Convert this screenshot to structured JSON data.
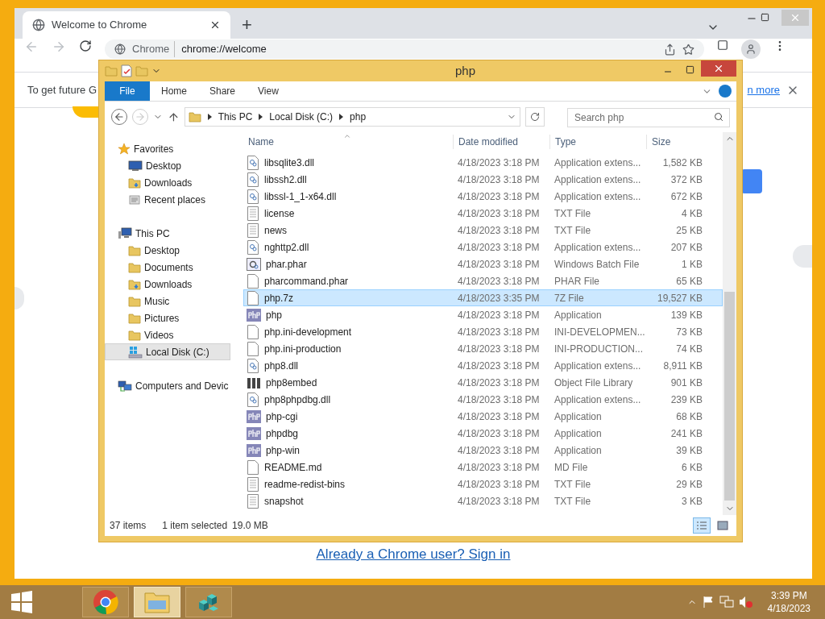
{
  "browser": {
    "tab": {
      "title": "Welcome to Chrome"
    },
    "new_tab": "+",
    "address": {
      "site": "Chrome",
      "url": "chrome://welcome"
    },
    "infobar": {
      "text": "To get future G",
      "link": "n more"
    },
    "sign_in_link": "Already a Chrome user? Sign in"
  },
  "explorer": {
    "title": "php",
    "ribbon_tabs": [
      {
        "label": "File",
        "kind": "file"
      },
      {
        "label": "Home",
        "kind": "tab"
      },
      {
        "label": "Share",
        "kind": "tab"
      },
      {
        "label": "View",
        "kind": "tab"
      }
    ],
    "breadcrumbs": [
      "This PC",
      "Local Disk (C:)",
      "php"
    ],
    "search": {
      "placeholder": "Search php"
    },
    "nav": [
      {
        "label": "Favorites",
        "kind": "star",
        "children": [
          {
            "label": "Desktop",
            "kind": "desktop",
            "selected": false
          },
          {
            "label": "Downloads",
            "kind": "downloads",
            "selected": false
          },
          {
            "label": "Recent places",
            "kind": "recent",
            "selected": false
          }
        ]
      },
      {
        "label": "This PC",
        "kind": "pc",
        "children": [
          {
            "label": "Desktop",
            "kind": "folder",
            "selected": false
          },
          {
            "label": "Documents",
            "kind": "folder",
            "selected": false
          },
          {
            "label": "Downloads",
            "kind": "downloads",
            "selected": false
          },
          {
            "label": "Music",
            "kind": "folder",
            "selected": false
          },
          {
            "label": "Pictures",
            "kind": "folder",
            "selected": false
          },
          {
            "label": "Videos",
            "kind": "folder",
            "selected": false
          },
          {
            "label": "Local Disk (C:)",
            "kind": "disk",
            "selected": true
          }
        ]
      },
      {
        "label": "Computers and Devic",
        "kind": "network"
      }
    ],
    "columns": [
      "Name",
      "Date modified",
      "Type",
      "Size"
    ],
    "rows": [
      {
        "name": "libsqlite3.dll",
        "date": "4/18/2023 3:18 PM",
        "type": "Application extens...",
        "size": "1,582 KB",
        "kind": "dll",
        "selected": false
      },
      {
        "name": "libssh2.dll",
        "date": "4/18/2023 3:18 PM",
        "type": "Application extens...",
        "size": "372 KB",
        "kind": "dll",
        "selected": false
      },
      {
        "name": "libssl-1_1-x64.dll",
        "date": "4/18/2023 3:18 PM",
        "type": "Application extens...",
        "size": "672 KB",
        "kind": "dll",
        "selected": false
      },
      {
        "name": "license",
        "date": "4/18/2023 3:18 PM",
        "type": "TXT File",
        "size": "4 KB",
        "kind": "text",
        "selected": false
      },
      {
        "name": "news",
        "date": "4/18/2023 3:18 PM",
        "type": "TXT File",
        "size": "25 KB",
        "kind": "text",
        "selected": false
      },
      {
        "name": "nghttp2.dll",
        "date": "4/18/2023 3:18 PM",
        "type": "Application extens...",
        "size": "207 KB",
        "kind": "dll",
        "selected": false
      },
      {
        "name": "phar.phar",
        "date": "4/18/2023 3:18 PM",
        "type": "Windows Batch File",
        "size": "1 KB",
        "kind": "batch",
        "selected": false
      },
      {
        "name": "pharcommand.phar",
        "date": "4/18/2023 3:18 PM",
        "type": "PHAR File",
        "size": "65 KB",
        "kind": "blank",
        "selected": false
      },
      {
        "name": "php.7z",
        "date": "4/18/2023 3:35 PM",
        "type": "7Z File",
        "size": "19,527 KB",
        "kind": "blank",
        "selected": true
      },
      {
        "name": "php",
        "date": "4/18/2023 3:18 PM",
        "type": "Application",
        "size": "139 KB",
        "kind": "php",
        "selected": false
      },
      {
        "name": "php.ini-development",
        "date": "4/18/2023 3:18 PM",
        "type": "INI-DEVELOPMEN...",
        "size": "73 KB",
        "kind": "blank",
        "selected": false
      },
      {
        "name": "php.ini-production",
        "date": "4/18/2023 3:18 PM",
        "type": "INI-PRODUCTION...",
        "size": "74 KB",
        "kind": "blank",
        "selected": false
      },
      {
        "name": "php8.dll",
        "date": "4/18/2023 3:18 PM",
        "type": "Application extens...",
        "size": "8,911 KB",
        "kind": "dll",
        "selected": false
      },
      {
        "name": "php8embed",
        "date": "4/18/2023 3:18 PM",
        "type": "Object File Library",
        "size": "901 KB",
        "kind": "lib",
        "selected": false
      },
      {
        "name": "php8phpdbg.dll",
        "date": "4/18/2023 3:18 PM",
        "type": "Application extens...",
        "size": "239 KB",
        "kind": "dll",
        "selected": false
      },
      {
        "name": "php-cgi",
        "date": "4/18/2023 3:18 PM",
        "type": "Application",
        "size": "68 KB",
        "kind": "php",
        "selected": false
      },
      {
        "name": "phpdbg",
        "date": "4/18/2023 3:18 PM",
        "type": "Application",
        "size": "241 KB",
        "kind": "php",
        "selected": false
      },
      {
        "name": "php-win",
        "date": "4/18/2023 3:18 PM",
        "type": "Application",
        "size": "39 KB",
        "kind": "php",
        "selected": false
      },
      {
        "name": "README.md",
        "date": "4/18/2023 3:18 PM",
        "type": "MD File",
        "size": "6 KB",
        "kind": "blank",
        "selected": false
      },
      {
        "name": "readme-redist-bins",
        "date": "4/18/2023 3:18 PM",
        "type": "TXT File",
        "size": "29 KB",
        "kind": "text",
        "selected": false
      },
      {
        "name": "snapshot",
        "date": "4/18/2023 3:18 PM",
        "type": "TXT File",
        "size": "3 KB",
        "kind": "text",
        "selected": false
      }
    ],
    "status": {
      "count": "37 items",
      "selection": "1 item selected",
      "size": "19.0 MB"
    },
    "views": [
      {
        "kind": "details",
        "selected": true
      },
      {
        "kind": "thumbs",
        "selected": false
      }
    ]
  },
  "taskbar": {
    "apps": [
      {
        "kind": "chrome",
        "selected": false
      },
      {
        "kind": "explorer",
        "selected": true
      },
      {
        "kind": "cubes",
        "selected": false
      }
    ],
    "time": "3:39 PM",
    "date": "4/18/2023"
  }
}
